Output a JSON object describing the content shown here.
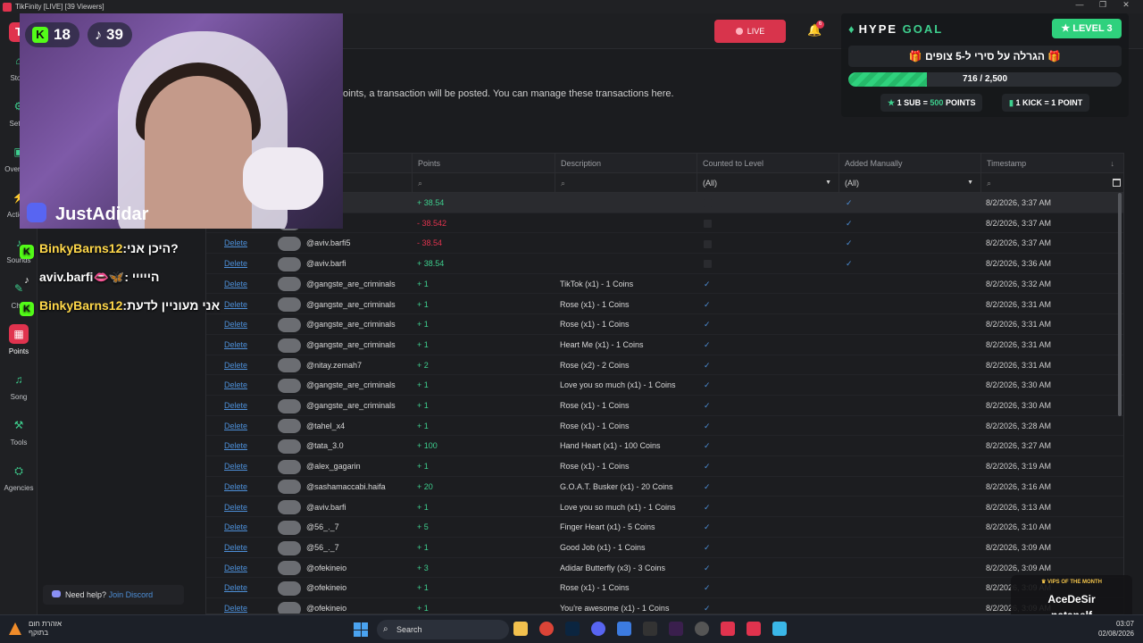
{
  "window": {
    "title": "TikFinity [LIVE] [39 Viewers]",
    "controls": [
      "—",
      "❐",
      "✕"
    ]
  },
  "sidebar": {
    "logo": "T",
    "items": [
      {
        "label": "Store",
        "icon": "store-icon",
        "glyph": "⌂"
      },
      {
        "label": "Setup",
        "icon": "setup-icon",
        "glyph": "⚙"
      },
      {
        "label": "Overlays",
        "icon": "overlays-icon",
        "glyph": "▣"
      },
      {
        "label": "Actions",
        "icon": "actions-icon",
        "glyph": "⚡"
      },
      {
        "label": "Sounds",
        "icon": "sounds-icon",
        "glyph": "♪"
      },
      {
        "label": "Chat",
        "icon": "chat-icon",
        "glyph": "✎"
      },
      {
        "label": "Points",
        "icon": "points-icon",
        "glyph": "▦",
        "active": true
      },
      {
        "label": "Song",
        "icon": "song-icon",
        "glyph": "♫"
      },
      {
        "label": "Tools",
        "icon": "tools-icon",
        "glyph": "⚒"
      },
      {
        "label": "Agencies",
        "icon": "agencies-icon",
        "glyph": "⛭"
      }
    ]
  },
  "topbar": {
    "live_label": "LIVE",
    "notification_count": "6"
  },
  "intro_text": "oints, a transaction will be posted. You can manage these transactions here.",
  "table": {
    "columns": [
      "Points",
      "Description",
      "Counted to Level",
      "Added Manually",
      "Timestamp"
    ],
    "filters": {
      "counted": "(All)",
      "manual": "(All)"
    },
    "rows": [
      {
        "action": "",
        "user": "i5",
        "points": "+ 38.54",
        "sign": "pos",
        "desc": "",
        "counted": "empty",
        "manual": true,
        "ts": "8/2/2026, 3:37 AM",
        "selected": true
      },
      {
        "action": "",
        "user": "i5",
        "points": "- 38.542",
        "sign": "neg",
        "desc": "",
        "counted": "empty",
        "manual": true,
        "ts": "8/2/2026, 3:37 AM"
      },
      {
        "action": "Delete",
        "user": "@aviv.barfi5",
        "points": "- 38.54",
        "sign": "neg",
        "desc": "",
        "counted": "empty",
        "manual": true,
        "ts": "8/2/2026, 3:37 AM"
      },
      {
        "action": "Delete",
        "user": "@aviv.barfi",
        "points": "+ 38.54",
        "sign": "pos",
        "desc": "",
        "counted": "empty",
        "manual": true,
        "ts": "8/2/2026, 3:36 AM"
      },
      {
        "action": "Delete",
        "user": "@gangste_are_criminals",
        "points": "+ 1",
        "sign": "pos",
        "desc": "TikTok (x1) - 1 Coins",
        "counted": "check",
        "manual": false,
        "ts": "8/2/2026, 3:32 AM"
      },
      {
        "action": "Delete",
        "user": "@gangste_are_criminals",
        "points": "+ 1",
        "sign": "pos",
        "desc": "Rose (x1) - 1 Coins",
        "counted": "check",
        "manual": false,
        "ts": "8/2/2026, 3:31 AM"
      },
      {
        "action": "Delete",
        "user": "@gangste_are_criminals",
        "points": "+ 1",
        "sign": "pos",
        "desc": "Rose (x1) - 1 Coins",
        "counted": "check",
        "manual": false,
        "ts": "8/2/2026, 3:31 AM"
      },
      {
        "action": "Delete",
        "user": "@gangste_are_criminals",
        "points": "+ 1",
        "sign": "pos",
        "desc": "Heart Me (x1) - 1 Coins",
        "counted": "check",
        "manual": false,
        "ts": "8/2/2026, 3:31 AM"
      },
      {
        "action": "Delete",
        "user": "@nitay.zemah7",
        "points": "+ 2",
        "sign": "pos",
        "desc": "Rose (x2) - 2 Coins",
        "counted": "check",
        "manual": false,
        "ts": "8/2/2026, 3:31 AM"
      },
      {
        "action": "Delete",
        "user": "@gangste_are_criminals",
        "points": "+ 1",
        "sign": "pos",
        "desc": "Love you so much (x1) - 1 Coins",
        "counted": "check",
        "manual": false,
        "ts": "8/2/2026, 3:30 AM"
      },
      {
        "action": "Delete",
        "user": "@gangste_are_criminals",
        "points": "+ 1",
        "sign": "pos",
        "desc": "Rose (x1) - 1 Coins",
        "counted": "check",
        "manual": false,
        "ts": "8/2/2026, 3:30 AM"
      },
      {
        "action": "Delete",
        "user": "@tahel_x4",
        "points": "+ 1",
        "sign": "pos",
        "desc": "Rose (x1) - 1 Coins",
        "counted": "check",
        "manual": false,
        "ts": "8/2/2026, 3:28 AM"
      },
      {
        "action": "Delete",
        "user": "@tata_3.0",
        "points": "+ 100",
        "sign": "pos",
        "desc": "Hand Heart (x1) - 100 Coins",
        "counted": "check",
        "manual": false,
        "ts": "8/2/2026, 3:27 AM"
      },
      {
        "action": "Delete",
        "user": "@alex_gagarin",
        "points": "+ 1",
        "sign": "pos",
        "desc": "Rose (x1) - 1 Coins",
        "counted": "check",
        "manual": false,
        "ts": "8/2/2026, 3:19 AM"
      },
      {
        "action": "Delete",
        "user": "@sashamaccabi.haifa",
        "points": "+ 20",
        "sign": "pos",
        "desc": "G.O.A.T. Busker (x1) - 20 Coins",
        "counted": "check",
        "manual": false,
        "ts": "8/2/2026, 3:16 AM"
      },
      {
        "action": "Delete",
        "user": "@aviv.barfi",
        "points": "+ 1",
        "sign": "pos",
        "desc": "Love you so much (x1) - 1 Coins",
        "counted": "check",
        "manual": false,
        "ts": "8/2/2026, 3:13 AM"
      },
      {
        "action": "Delete",
        "user": "@56_._7",
        "points": "+ 5",
        "sign": "pos",
        "desc": "Finger Heart (x1) - 5 Coins",
        "counted": "check",
        "manual": false,
        "ts": "8/2/2026, 3:10 AM"
      },
      {
        "action": "Delete",
        "user": "@56_._7",
        "points": "+ 1",
        "sign": "pos",
        "desc": "Good Job (x1) - 1 Coins",
        "counted": "check",
        "manual": false,
        "ts": "8/2/2026, 3:09 AM"
      },
      {
        "action": "Delete",
        "user": "@ofekineio",
        "points": "+ 3",
        "sign": "pos",
        "desc": "Adidar Butterfly (x3) - 3 Coins",
        "counted": "check",
        "manual": false,
        "ts": "8/2/2026, 3:09 AM"
      },
      {
        "action": "Delete",
        "user": "@ofekineio",
        "points": "+ 1",
        "sign": "pos",
        "desc": "Rose (x1) - 1 Coins",
        "counted": "check",
        "manual": false,
        "ts": "8/2/2026, 3:09 AM"
      },
      {
        "action": "Delete",
        "user": "@ofekineio",
        "points": "+ 1",
        "sign": "pos",
        "desc": "You're awesome (x1) - 1 Coins",
        "counted": "check",
        "manual": false,
        "ts": "8/2/2026, 3:09 AM"
      }
    ]
  },
  "webcam": {
    "kick_viewers": "18",
    "tiktok_viewers": "39",
    "streamer_name": "JustAdidar"
  },
  "chat": [
    {
      "platform": "kick",
      "user": "BinkyBarns12",
      "message": ":היכן אני?"
    },
    {
      "platform": "tiktok",
      "user": "aviv.barfi",
      "emoji": "👄🦋",
      "message": ": הייייי"
    },
    {
      "platform": "kick",
      "user": "BinkyBarns12",
      "message": ":אני מעוניין לדעת"
    }
  ],
  "hype_goal": {
    "title_main": "HYPE",
    "title_accent": "GOAL",
    "level": "LEVEL 3",
    "goal_title": "הגרלה על סירי ל-5 צופים",
    "current": 716,
    "target": 2500,
    "progress_text": "716 / 2,500",
    "rule1": {
      "a": "1 SUB",
      "eq": "=",
      "b": "500",
      "c": "POINTS"
    },
    "rule2": {
      "a": "1 KICK",
      "eq": "=",
      "b": "1 POINT"
    }
  },
  "help": {
    "label": "Need help?",
    "link": "Join Discord"
  },
  "vip": {
    "header": "VIPS OF THE MONTH",
    "name1": "AceDeSir",
    "name2": "natanelf"
  },
  "taskbar": {
    "weather_line1": "אזהרת חום",
    "weather_line2": "בתוקף",
    "search_label": "Search",
    "time": "03:07",
    "date": "02/08/2026"
  },
  "colors": {
    "accent": "#e0334e",
    "green": "#3ecf8e",
    "link": "#4d8fd8"
  }
}
